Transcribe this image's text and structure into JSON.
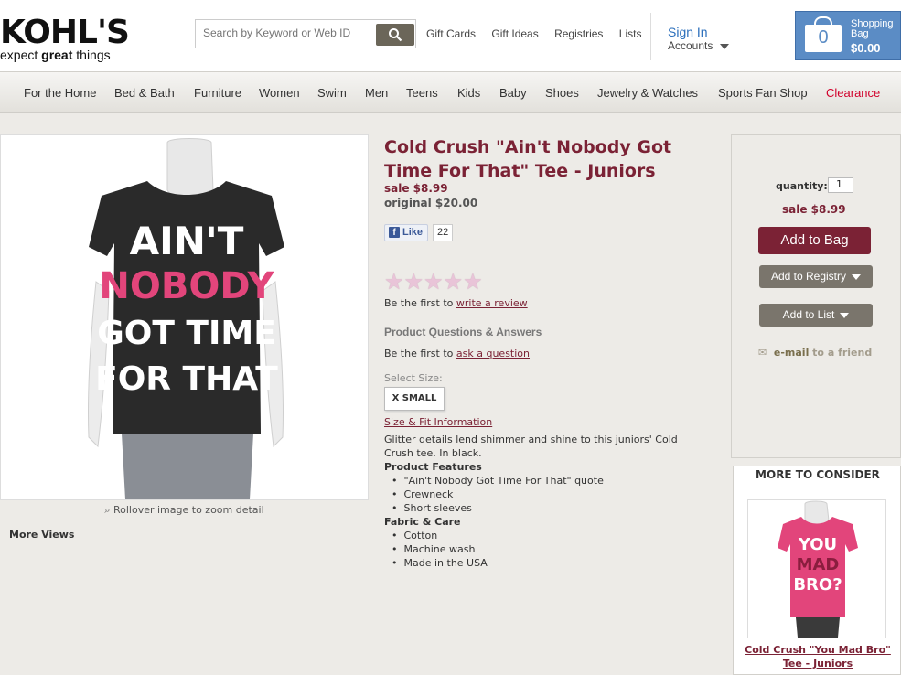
{
  "header": {
    "logo": "KOHL'S",
    "tagline_pre": "expect ",
    "tagline_bold": "great",
    "tagline_post": " things",
    "search_placeholder": "Search by Keyword or Web ID",
    "top_links": [
      "Gift Cards",
      "Gift Ideas",
      "Registries",
      "Lists"
    ],
    "sign_in": "Sign In",
    "accounts": "Accounts",
    "bag_count": "0",
    "bag_label": "Shopping Bag",
    "bag_amount": "$0.00"
  },
  "nav": [
    {
      "label": "For the Home"
    },
    {
      "label": "Bed & Bath"
    },
    {
      "label": "Furniture"
    },
    {
      "label": "Women"
    },
    {
      "label": "Swim"
    },
    {
      "label": "Men"
    },
    {
      "label": "Teens"
    },
    {
      "label": "Kids"
    },
    {
      "label": "Baby"
    },
    {
      "label": "Shoes"
    },
    {
      "label": "Jewelry & Watches"
    },
    {
      "label": "Sports Fan Shop"
    },
    {
      "label": "Clearance"
    }
  ],
  "product": {
    "image_text": [
      "AIN'T",
      "NOBODY",
      "GOT TIME",
      "FOR THAT"
    ],
    "rollover": "Rollover image to zoom detail",
    "more_views": "More Views",
    "title": "Cold Crush \"Ain't Nobody Got Time For That\" Tee - Juniors",
    "sale_price": "sale $8.99",
    "original_price": "original $20.00",
    "fb_like": "Like",
    "fb_count": "22",
    "rating_stars": 0,
    "review_pre": "Be the first to ",
    "review_link": "write a review",
    "qa_heading": "Product Questions & Answers",
    "ask_pre": "Be the first to ",
    "ask_link": "ask a question",
    "select_size_label": "Select Size:",
    "size_option": "X SMALL",
    "size_fit_link": "Size & Fit Information",
    "description": "Glitter details lend shimmer and shine to this juniors' Cold Crush tee. In black.",
    "features_heading": "Product Features",
    "features": [
      "\"Ain't Nobody Got Time For That\" quote",
      "Crewneck",
      "Short sleeves"
    ],
    "care_heading": "Fabric & Care",
    "care": [
      "Cotton",
      "Machine wash",
      "Made in the USA"
    ]
  },
  "buy": {
    "quantity_label": "quantity:",
    "quantity_value": "1",
    "sale_price": "sale $8.99",
    "add_to_bag": "Add to Bag",
    "add_to_registry": "Add to Registry",
    "add_to_list": "Add to List",
    "email_link": "e-mail",
    "email_rest": " to a friend"
  },
  "more_to_consider": {
    "heading": "MORE TO CONSIDER",
    "image_text": [
      "YOU",
      "MAD",
      "BRO?"
    ],
    "item_title": "Cold Crush \"You Mad Bro\" Tee - Juniors"
  },
  "colors": {
    "brand_burgundy": "#7b2235",
    "clearance_red": "#d1002b",
    "link_blue": "#2a6ebb",
    "bag_blue": "#5b8cc5",
    "pink": "#e2457b"
  }
}
